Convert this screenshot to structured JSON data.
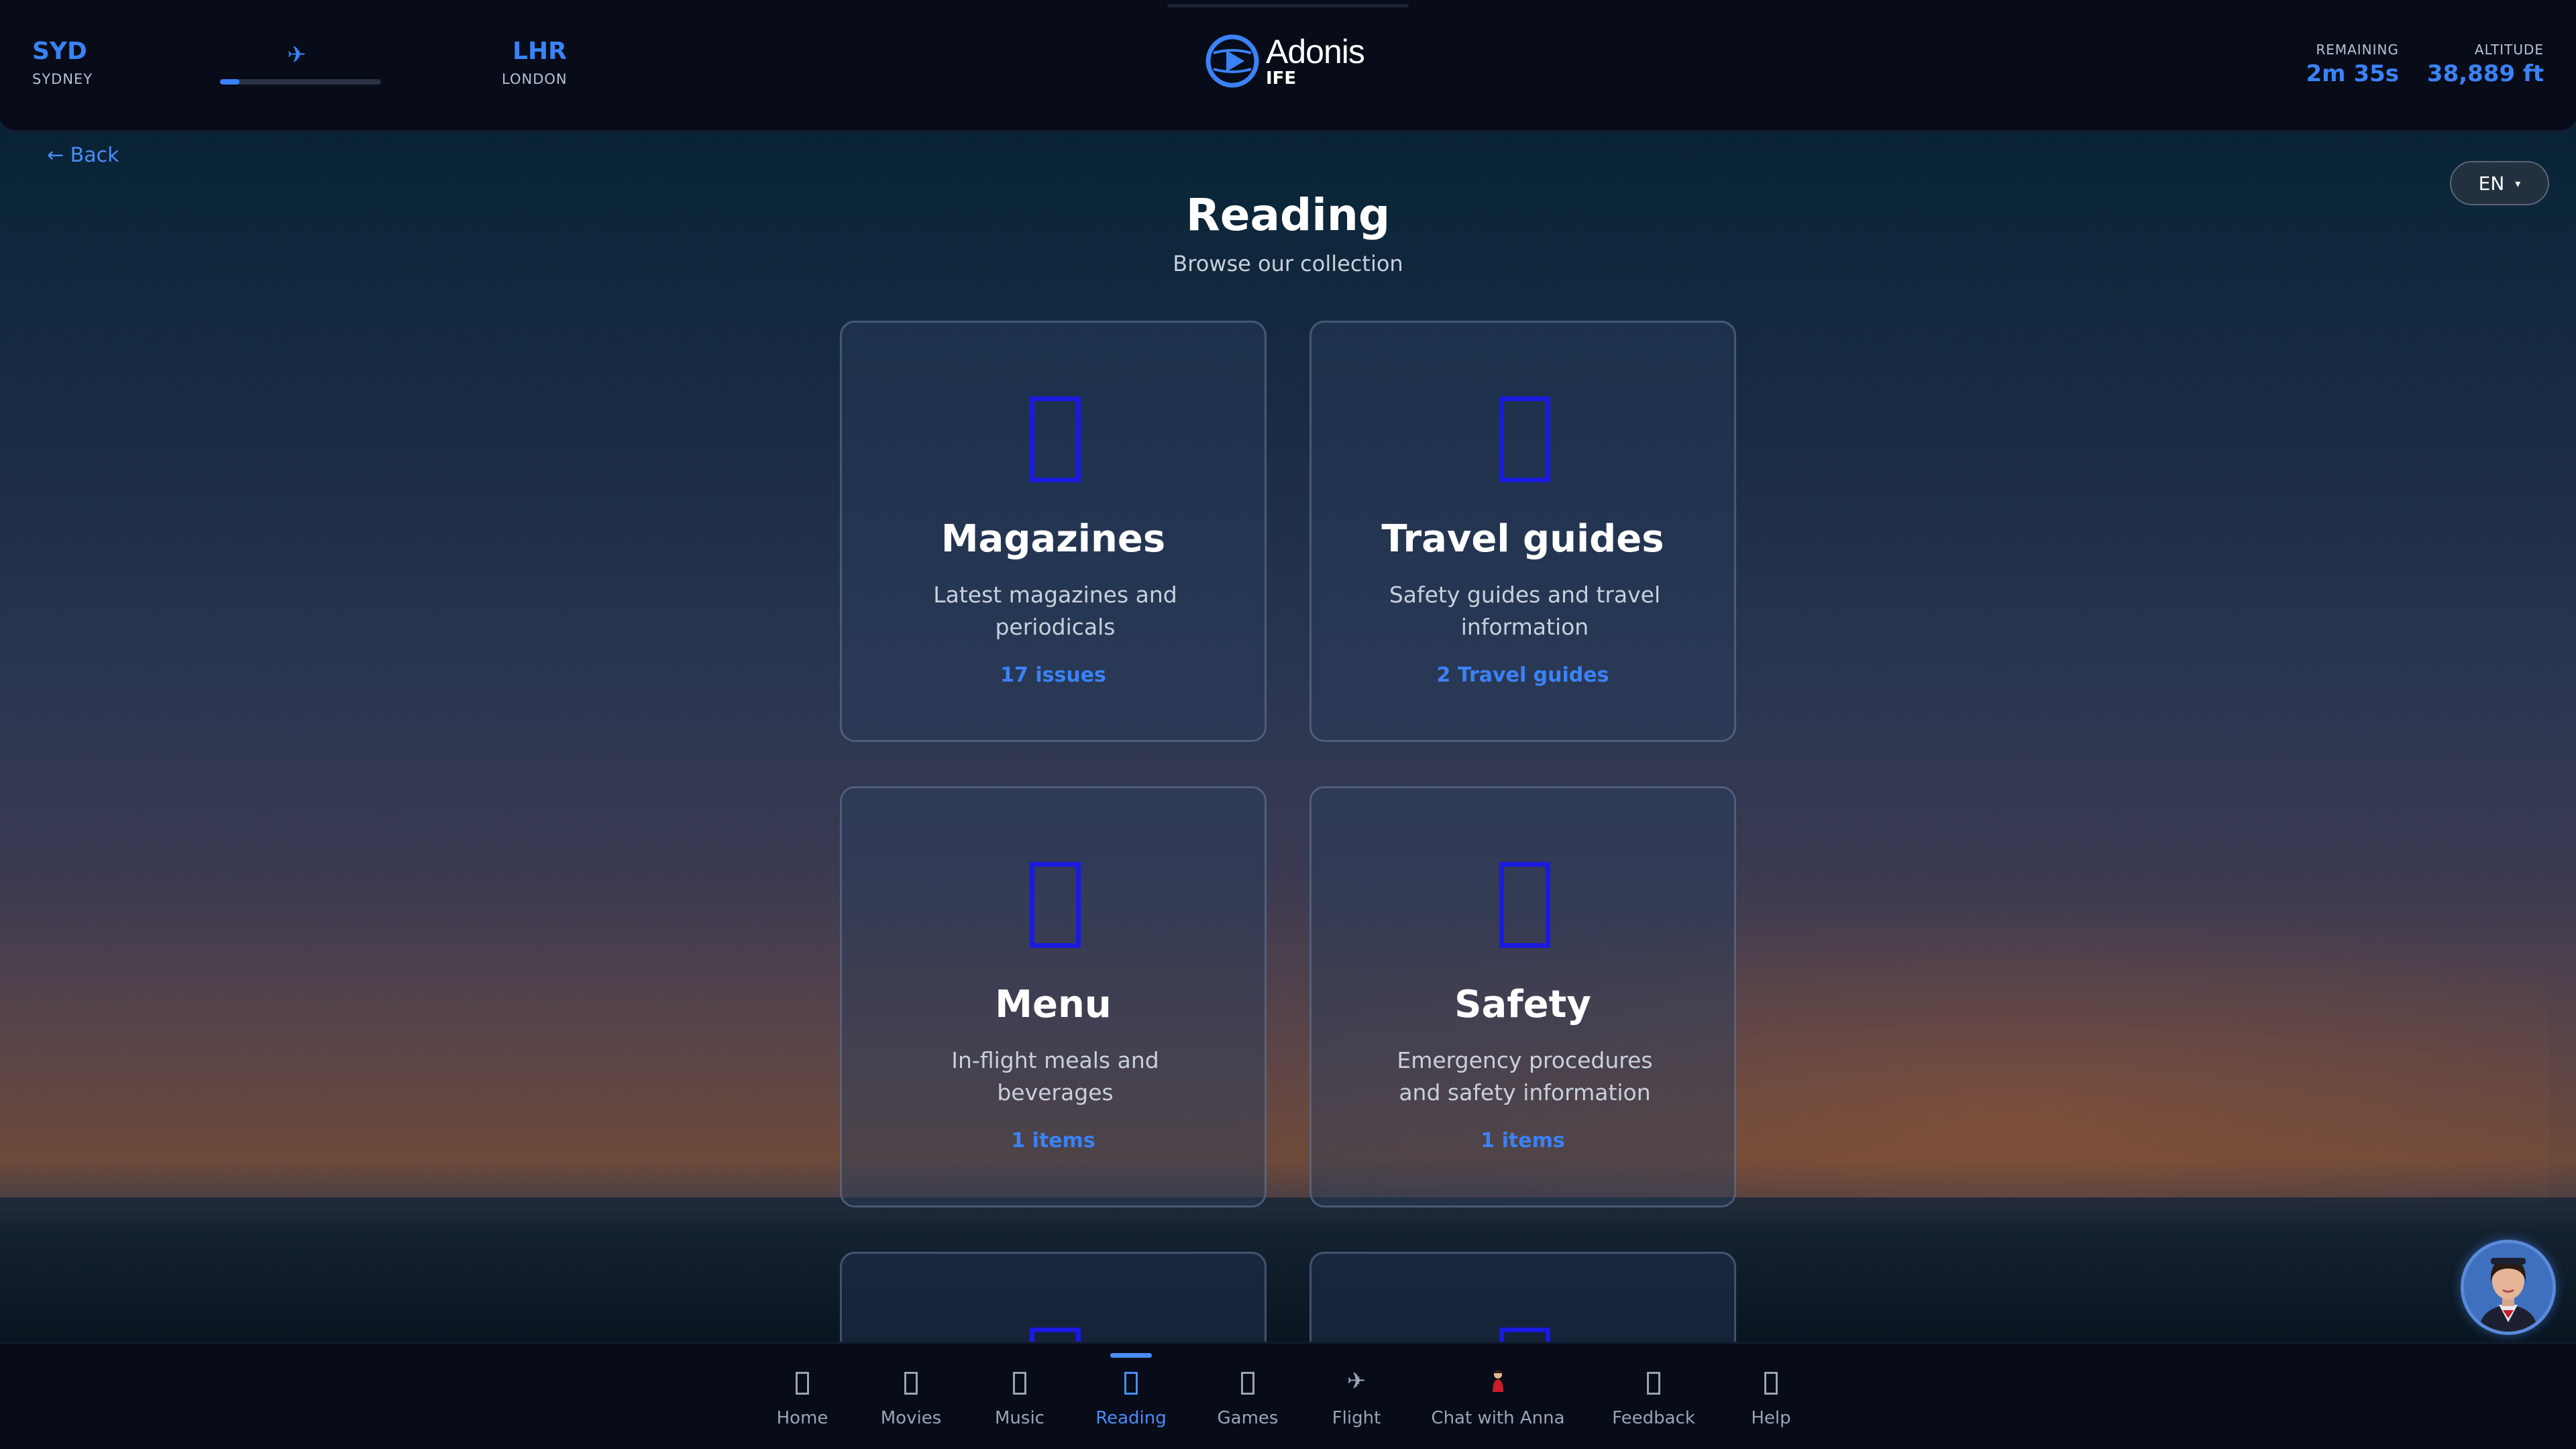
{
  "header": {
    "origin": {
      "code": "SYD",
      "city": "SYDNEY"
    },
    "destination": {
      "code": "LHR",
      "city": "LONDON"
    },
    "flight_progress": 0.12,
    "logo": {
      "name": "Adonis",
      "sub": "IFE"
    },
    "remaining": {
      "label": "REMAINING",
      "value": "2m 35s"
    },
    "altitude": {
      "label": "ALTITUDE",
      "value": "38,889 ft"
    }
  },
  "back_label": "← Back",
  "language": {
    "selected": "EN",
    "caret": "▾"
  },
  "page": {
    "title": "Reading",
    "subtitle": "Browse our collection"
  },
  "categories": [
    {
      "icon": "magazine-icon",
      "title": "Magazines",
      "description": "Latest magazines and periodicals",
      "count": "17 issues"
    },
    {
      "icon": "travel-guide-icon",
      "title": "Travel guides",
      "description": "Safety guides and travel information",
      "count": "2 Travel guides"
    },
    {
      "icon": "menu-icon",
      "title": "Menu",
      "description": "In-flight meals and beverages",
      "count": "1 items"
    },
    {
      "icon": "safety-icon",
      "title": "Safety",
      "description": "Emergency procedures and safety information",
      "count": "1 items"
    }
  ],
  "nav": {
    "items": [
      {
        "label": "Home",
        "icon": "home-icon"
      },
      {
        "label": "Movies",
        "icon": "movies-icon"
      },
      {
        "label": "Music",
        "icon": "music-icon"
      },
      {
        "label": "Reading",
        "icon": "reading-icon",
        "active": true
      },
      {
        "label": "Games",
        "icon": "games-icon"
      },
      {
        "label": "Flight",
        "icon": "plane-icon"
      },
      {
        "label": "Chat with Anna",
        "icon": "anna-icon"
      },
      {
        "label": "Feedback",
        "icon": "feedback-icon"
      },
      {
        "label": "Help",
        "icon": "help-icon"
      }
    ]
  },
  "colors": {
    "accent": "#3b82f6",
    "header_bg": "#070c18",
    "icon_placeholder": "#1a1ae0"
  }
}
